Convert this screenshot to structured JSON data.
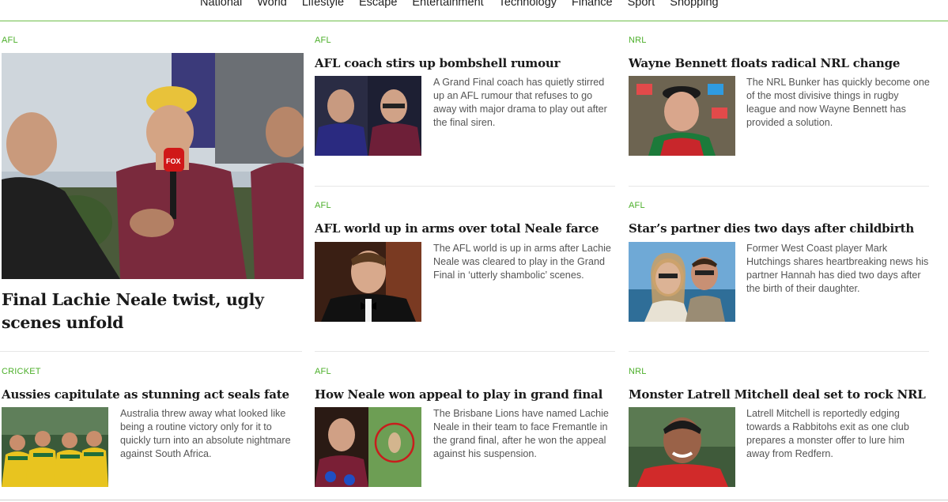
{
  "nav": {
    "items": [
      "National",
      "World",
      "Lifestyle",
      "Escape",
      "Entertainment",
      "Technology",
      "Finance",
      "Sport",
      "Shopping"
    ]
  },
  "featured": {
    "category": "AFL",
    "headline": "Final Lachie Neale twist, ugly scenes unfold",
    "mic_flag": "FOX"
  },
  "stories": [
    {
      "category": "AFL",
      "headline": "AFL coach stirs up bombshell rumour",
      "blurb": "A Grand Final coach has quietly stirred up an AFL rumour that refuses to go away with major drama to play out after the final siren."
    },
    {
      "category": "NRL",
      "headline": "Wayne Bennett floats radical NRL change",
      "blurb": "The NRL Bunker has quickly become one of the most divisive things in rugby league and now Wayne Bennett has provided a solution."
    },
    {
      "category": "AFL",
      "headline": "AFL world up in arms over total Neale farce",
      "blurb": "The AFL world is up in arms after Lachie Neale was cleared to play in the Grand Final in ‘utterly shambolic’ scenes."
    },
    {
      "category": "AFL",
      "headline": "Star’s partner dies two days after childbirth",
      "blurb": "Former West Coast player Mark Hutchings shares heartbreaking news his partner Hannah has died two days after the birth of their daughter."
    },
    {
      "category": "CRICKET",
      "headline": "Aussies capitulate as stunning act seals fate",
      "blurb": "Australia threw away what looked like being a routine victory only for it to quickly turn into an absolute nightmare against South Africa."
    },
    {
      "category": "AFL",
      "headline": "How Neale won appeal to play in grand final",
      "blurb": "The Brisbane Lions have named Lachie Neale in their team to face Fremantle in the grand final, after he won the appeal against his suspension."
    },
    {
      "category": "NRL",
      "headline": "Monster Latrell Mitchell deal set to rock NRL",
      "blurb": "Latrell Mitchell is reportedly edging towards a Rabbitohs exit as one club prepares a monster offer to lure him away from Redfern."
    }
  ],
  "colors": {
    "accent": "#4caf2a",
    "nav_rule": "#6fbf4a"
  }
}
